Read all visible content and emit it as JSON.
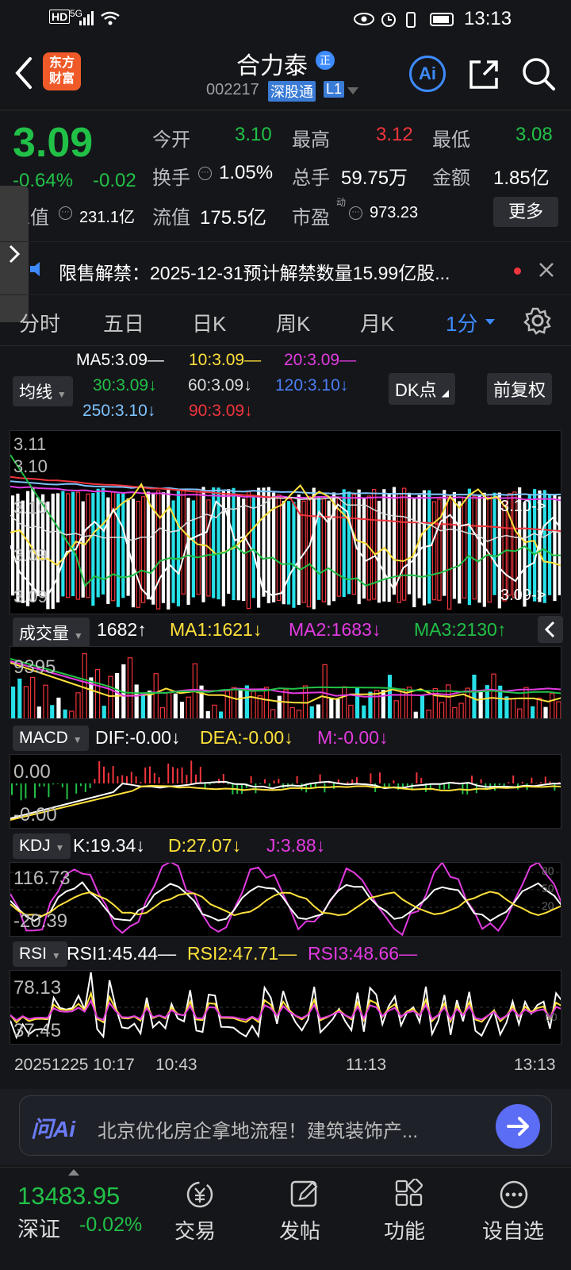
{
  "status": {
    "time": "13:13",
    "network": "5G",
    "hd": "HD"
  },
  "header": {
    "name": "合力泰",
    "badge": "正",
    "code": "002217",
    "market": "深股通",
    "level": "L1",
    "logo_line1": "东方",
    "logo_line2": "财富",
    "ai": "Ai"
  },
  "quote": {
    "price": "3.09",
    "pct": "-0.64%",
    "chg": "-0.02",
    "open_label": "今开",
    "open": "3.10",
    "high_label": "最高",
    "high": "3.12",
    "low_label": "最低",
    "low": "3.08",
    "turnover_label": "换手",
    "turnover": "1.05%",
    "vol_label": "总手",
    "vol": "59.75万",
    "amount_label": "金额",
    "amount": "1.85亿",
    "mktcap_label": "总值",
    "mktcap": "231.1亿",
    "float_label": "流值",
    "float": "175.5亿",
    "pe_label": "市盈",
    "pe_sup": "动",
    "pe": "973.23",
    "more": "更多"
  },
  "notice": {
    "text": "限售解禁：2025-12-31预计解禁数量15.99亿股..."
  },
  "tabs": [
    "分时",
    "五日",
    "日K",
    "周K",
    "月K",
    "1分"
  ],
  "ma": {
    "toggle": "均线",
    "ma5": "MA5:3.09",
    "ma10": "10:3.09",
    "ma20": "20:3.09",
    "ma30": "30:3.09",
    "ma60": "60:3.09",
    "ma120": "120:3.10",
    "ma250": "250:3.10",
    "ma90": "90:3.09",
    "dk": "DK点",
    "fq": "前复权"
  },
  "main_chart": {
    "y_top": "3.11",
    "y_2": "3.10",
    "y_3": "3.10",
    "y_4": "3.09",
    "y_bottom": "3.09",
    "right_top": "3.10",
    "right_bottom": "3.09"
  },
  "volume": {
    "label": "成交量",
    "cur": "1682",
    "ma1": "MA1:1621",
    "ma2": "MA2:1683",
    "ma3": "MA3:2130",
    "max": "9395"
  },
  "macd": {
    "label": "MACD",
    "dif": "DIF:-0.00",
    "dea": "DEA:-0.00",
    "m": "M:-0.00",
    "top": "0.00",
    "bottom": "-0.00"
  },
  "kdj": {
    "label": "KDJ",
    "k": "K:19.34",
    "d": "D:27.07",
    "j": "J:3.88",
    "top": "116.73",
    "bottom": "-20.39",
    "r80": "80",
    "r50": "50",
    "r20": "20"
  },
  "rsi": {
    "label": "RSI",
    "r1": "RSI1:45.44",
    "r2": "RSI2:47.71",
    "r3": "RSI3:48.66",
    "top": "78.13",
    "bottom": "37.45",
    "r50": "50"
  },
  "time_axis": {
    "t0": "20251225 10:17",
    "t1": "10:43",
    "t2": "11:13",
    "t3": "13:13"
  },
  "ask_ai": {
    "logo": "问Ai",
    "text": "北京优化房企拿地流程！建筑装饰产..."
  },
  "bottom": {
    "index_value": "13483.95",
    "index_name": "深证",
    "index_pct": "-0.02%",
    "nav": [
      "交易",
      "发帖",
      "功能",
      "设自选"
    ]
  },
  "colors": {
    "up": "#f0353c",
    "down": "#21c147",
    "accent": "#3d8bff",
    "cyan": "#27e0e8"
  }
}
